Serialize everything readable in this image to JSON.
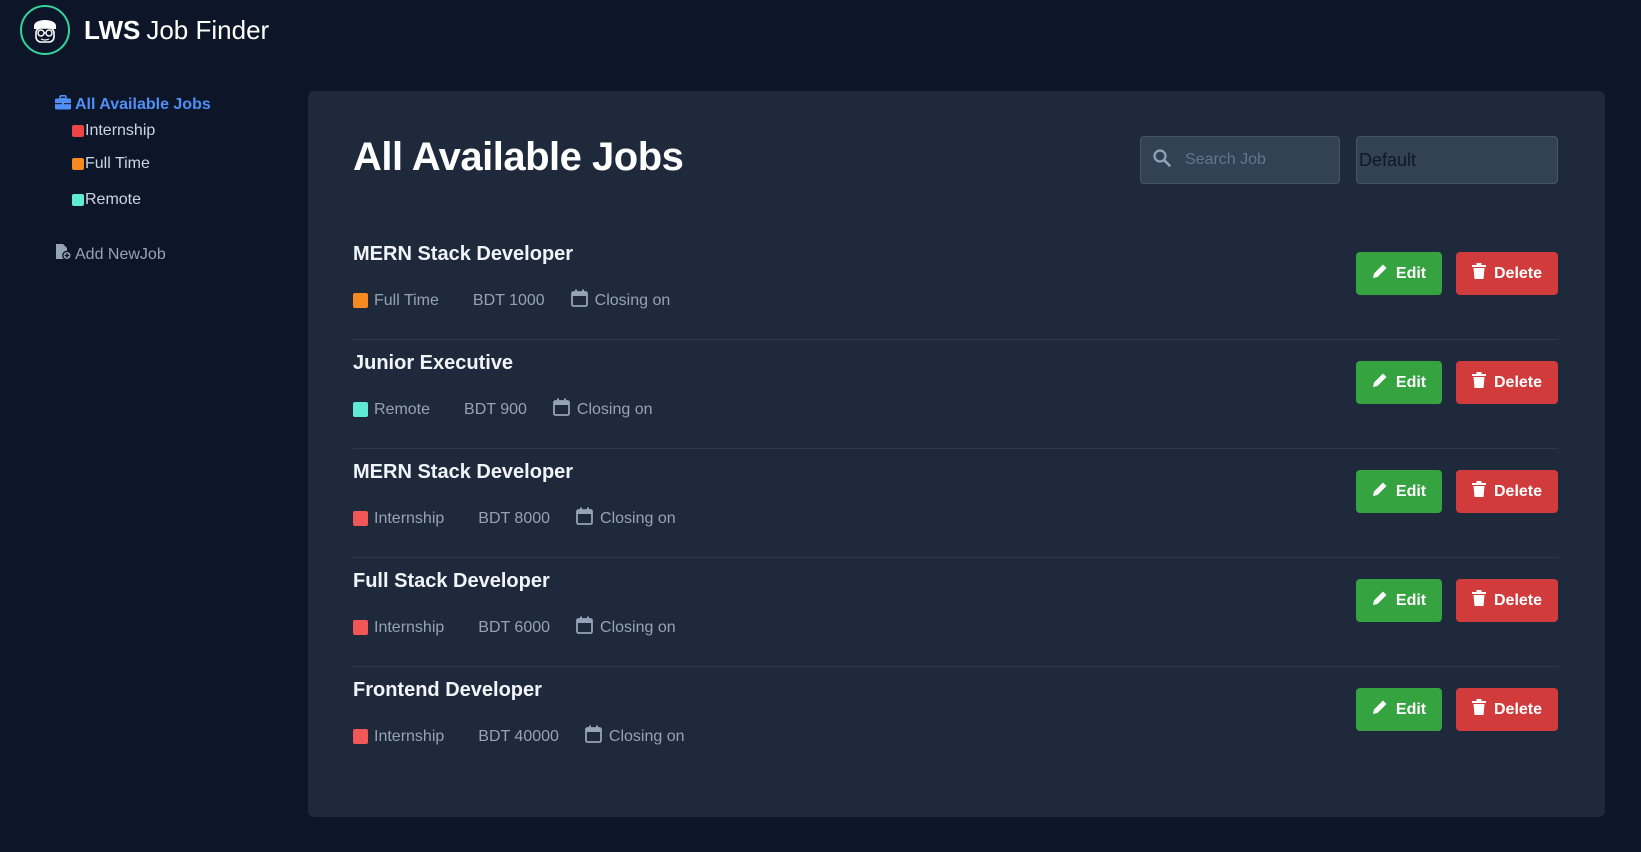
{
  "header": {
    "brand_bold": "LWS",
    "brand_rest": "Job Finder"
  },
  "sidebar": {
    "main_label": "All Available Jobs",
    "items": [
      {
        "label": "Internship",
        "color": "#ef4444"
      },
      {
        "label": "Full Time",
        "color": "#f6891f"
      },
      {
        "label": "Remote",
        "color": "#5eead4"
      }
    ],
    "add_label": "Add NewJob"
  },
  "main": {
    "title": "All Available Jobs",
    "search": {
      "placeholder": "Search Job",
      "value": ""
    },
    "sort": {
      "selected": "Default"
    },
    "edit_label": "Edit",
    "delete_label": "Delete",
    "jobs": [
      {
        "title": "MERN Stack Developer",
        "type": "Full Time",
        "type_color": "#f6891f",
        "salary": "BDT 1000",
        "closing": "Closing on"
      },
      {
        "title": "Junior Executive",
        "type": "Remote",
        "type_color": "#5eead4",
        "salary": "BDT 900",
        "closing": "Closing on"
      },
      {
        "title": "MERN Stack Developer",
        "type": "Internship",
        "type_color": "#f15757",
        "salary": "BDT 8000",
        "closing": "Closing on"
      },
      {
        "title": "Full Stack Developer",
        "type": "Internship",
        "type_color": "#f15757",
        "salary": "BDT 6000",
        "closing": "Closing on"
      },
      {
        "title": "Frontend Developer",
        "type": "Internship",
        "type_color": "#f15757",
        "salary": "BDT 40000",
        "closing": "Closing on"
      }
    ]
  }
}
